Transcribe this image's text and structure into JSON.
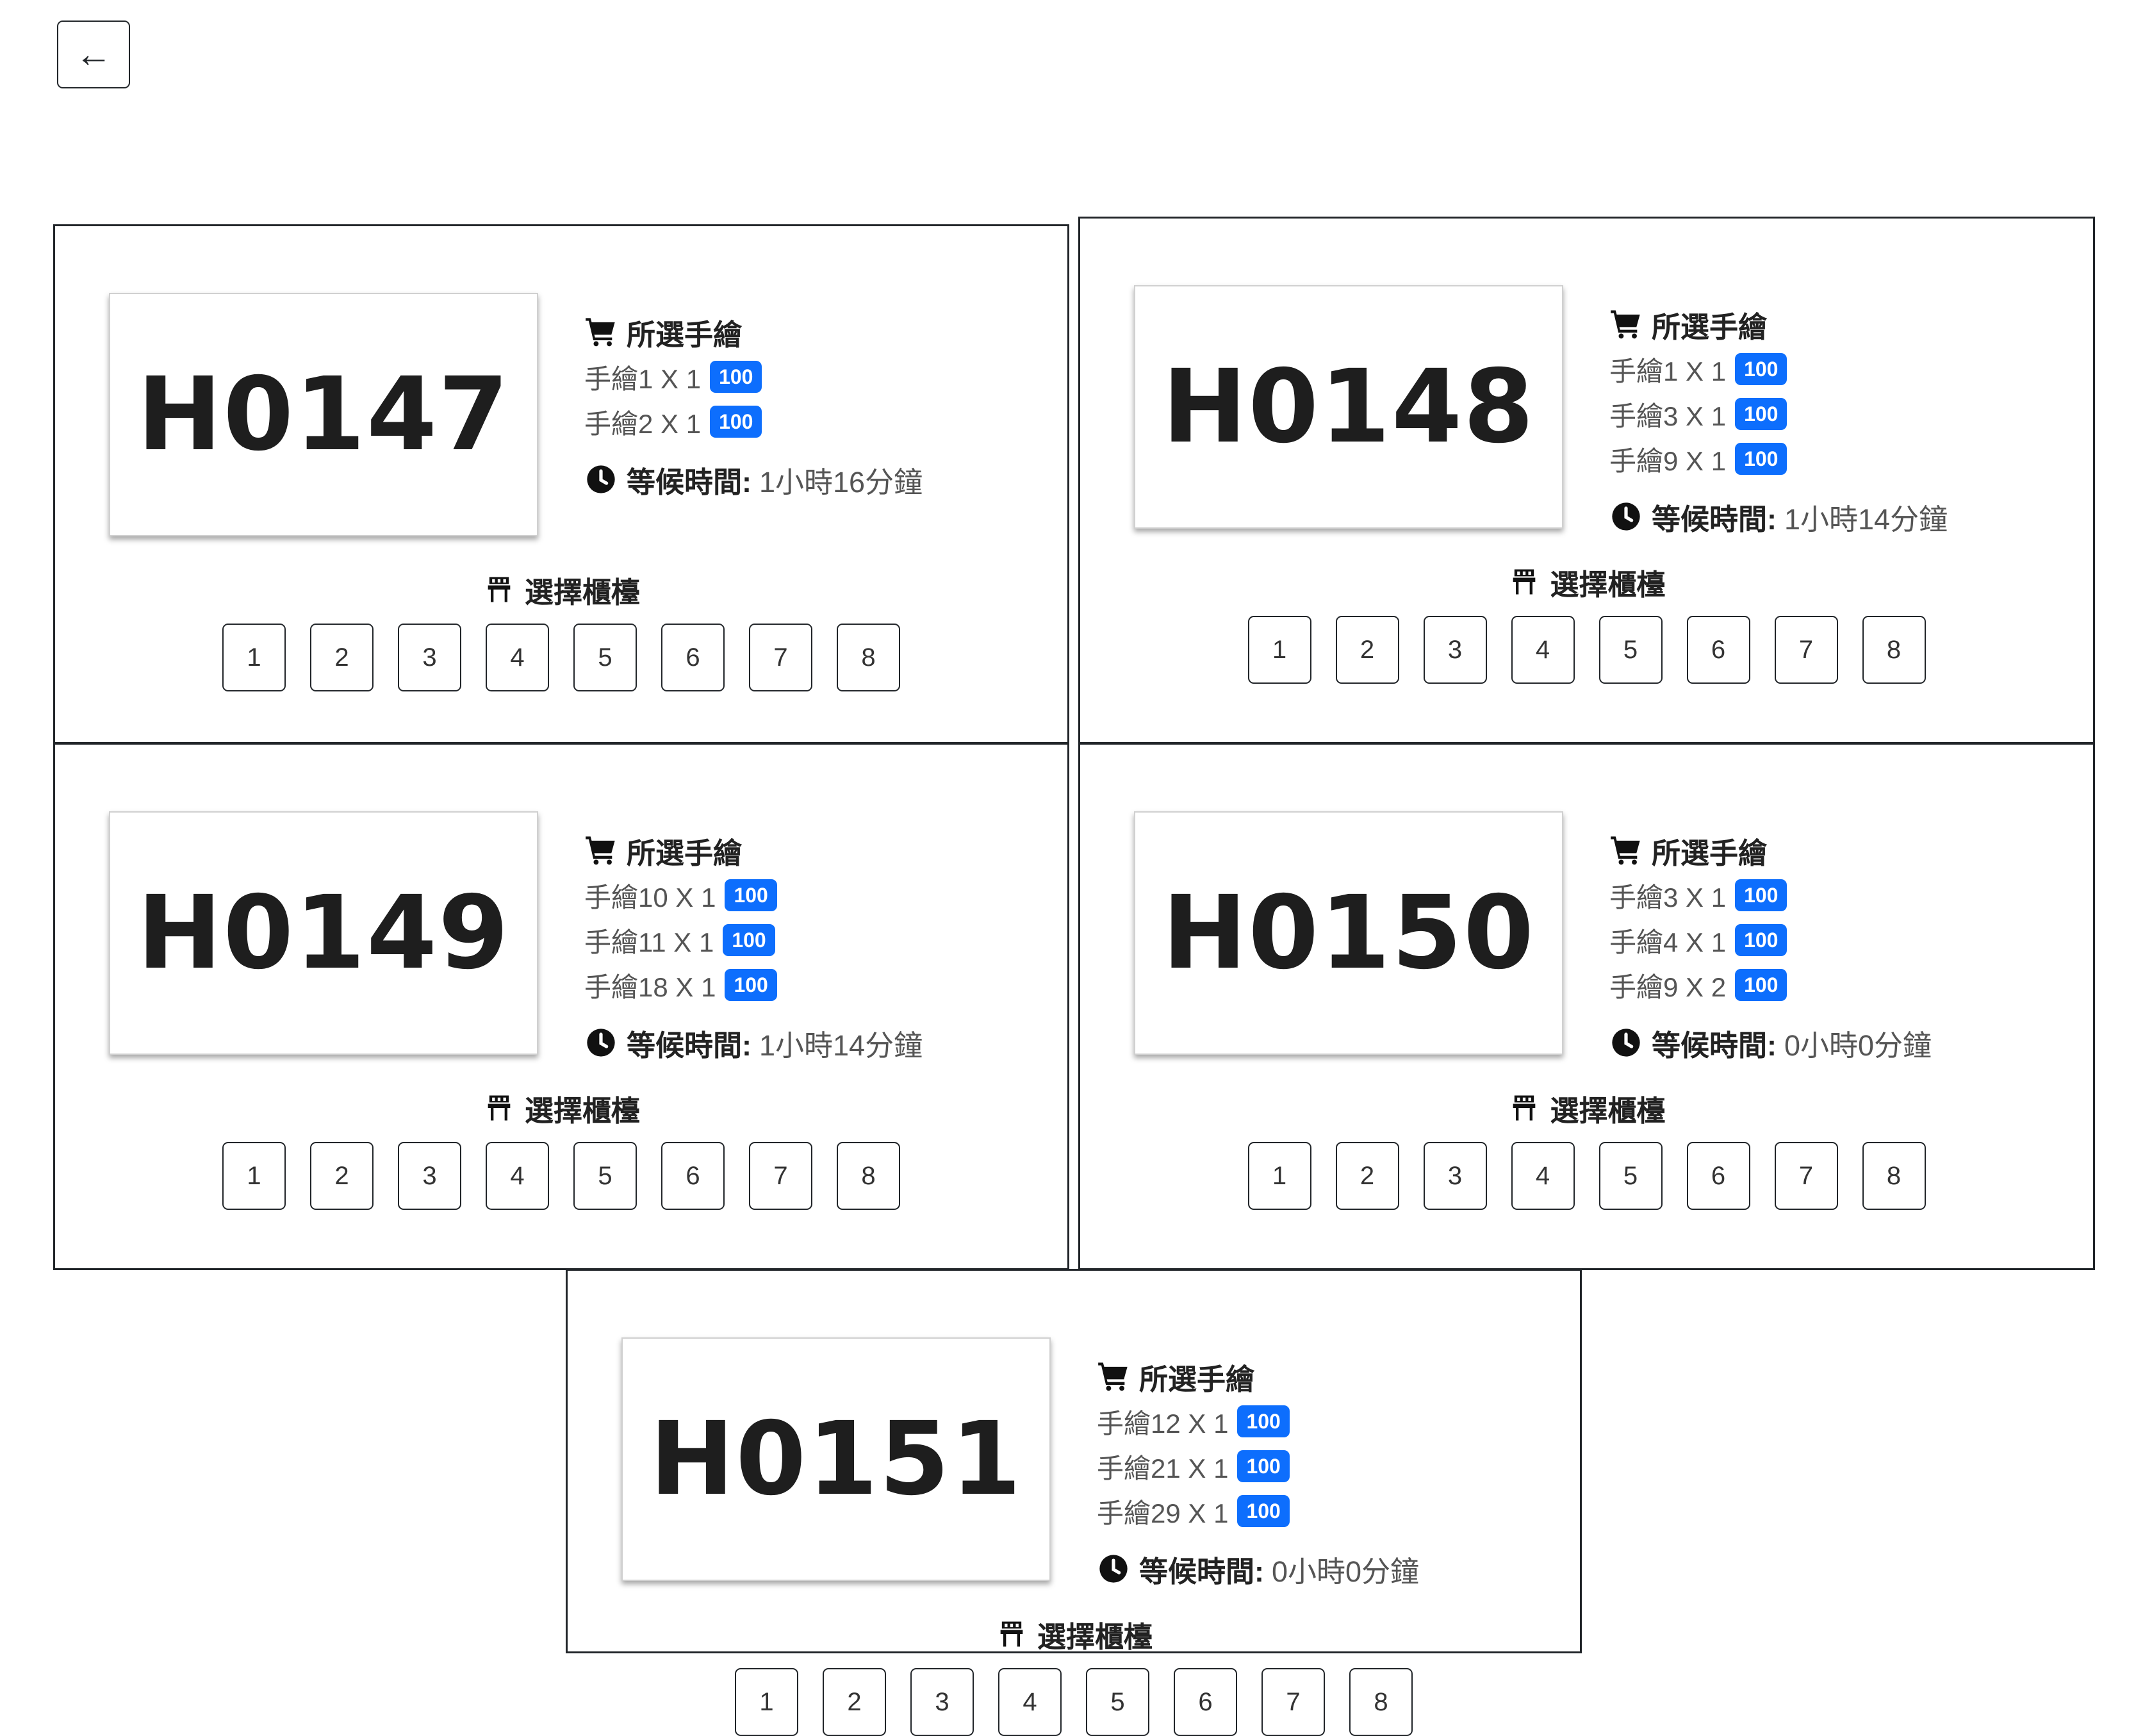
{
  "toolbar": {
    "back_label": "←"
  },
  "labels": {
    "items_heading": "所選手繪",
    "wait_label": "等候時間:",
    "stall_heading": "選擇櫃檯"
  },
  "colors": {
    "badge": "#0d6efd",
    "border": "#212529"
  },
  "icons": {
    "cart": "cart-icon",
    "clock": "clock-icon",
    "stall": "chair-icon"
  },
  "stalls": [
    "1",
    "2",
    "3",
    "4",
    "5",
    "6",
    "7",
    "8"
  ],
  "orders": [
    {
      "code": "H0147",
      "items": [
        {
          "text": "手繪1 X 1",
          "badge": "100"
        },
        {
          "text": "手繪2 X 1",
          "badge": "100"
        }
      ],
      "wait": "1小時16分鐘"
    },
    {
      "code": "H0148",
      "items": [
        {
          "text": "手繪1 X 1",
          "badge": "100"
        },
        {
          "text": "手繪3 X 1",
          "badge": "100"
        },
        {
          "text": "手繪9 X 1",
          "badge": "100"
        }
      ],
      "wait": "1小時14分鐘"
    },
    {
      "code": "H0149",
      "items": [
        {
          "text": "手繪10 X 1",
          "badge": "100"
        },
        {
          "text": "手繪11 X 1",
          "badge": "100"
        },
        {
          "text": "手繪18 X 1",
          "badge": "100"
        }
      ],
      "wait": "1小時14分鐘"
    },
    {
      "code": "H0150",
      "items": [
        {
          "text": "手繪3 X 1",
          "badge": "100"
        },
        {
          "text": "手繪4 X 1",
          "badge": "100"
        },
        {
          "text": "手繪9 X 2",
          "badge": "100"
        }
      ],
      "wait": "0小時0分鐘"
    },
    {
      "code": "H0151",
      "items": [
        {
          "text": "手繪12 X 1",
          "badge": "100"
        },
        {
          "text": "手繪21 X 1",
          "badge": "100"
        },
        {
          "text": "手繪29 X 1",
          "badge": "100"
        }
      ],
      "wait": "0小時0分鐘"
    }
  ]
}
